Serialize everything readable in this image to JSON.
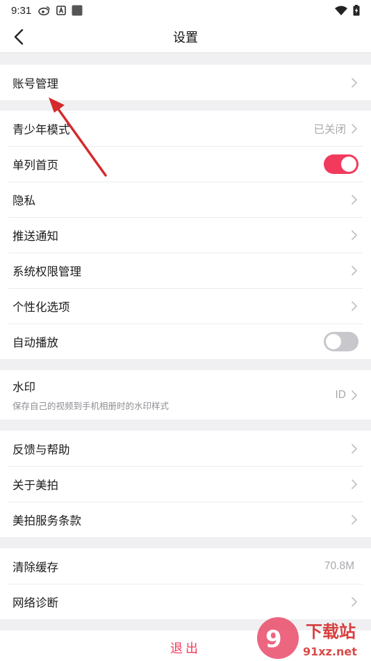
{
  "status_bar": {
    "time": "9:31"
  },
  "nav": {
    "title": "设置"
  },
  "groups": [
    [
      {
        "label": "账号管理"
      }
    ],
    [
      {
        "label": "青少年模式",
        "value": "已关闭"
      },
      {
        "label": "单列首页",
        "toggle": "on"
      },
      {
        "label": "隐私"
      },
      {
        "label": "推送通知"
      },
      {
        "label": "系统权限管理"
      },
      {
        "label": "个性化选项"
      },
      {
        "label": "自动播放",
        "toggle": "off"
      }
    ],
    [
      {
        "label": "水印",
        "sub": "保存自己的视频到手机相册时的水印样式",
        "value": "ID"
      }
    ],
    [
      {
        "label": "反馈与帮助"
      },
      {
        "label": "关于美拍"
      },
      {
        "label": "美拍服务条款"
      }
    ],
    [
      {
        "label": "清除缓存",
        "value": "70.8M"
      },
      {
        "label": "网络诊断"
      }
    ]
  ],
  "logout": {
    "label": "退出"
  },
  "watermark": {
    "big": "下载站",
    "small": "91xz.net"
  },
  "colors": {
    "accent": "#f23a5c",
    "annotation_arrow": "#d42a2a",
    "background": "#f0f0f2"
  }
}
